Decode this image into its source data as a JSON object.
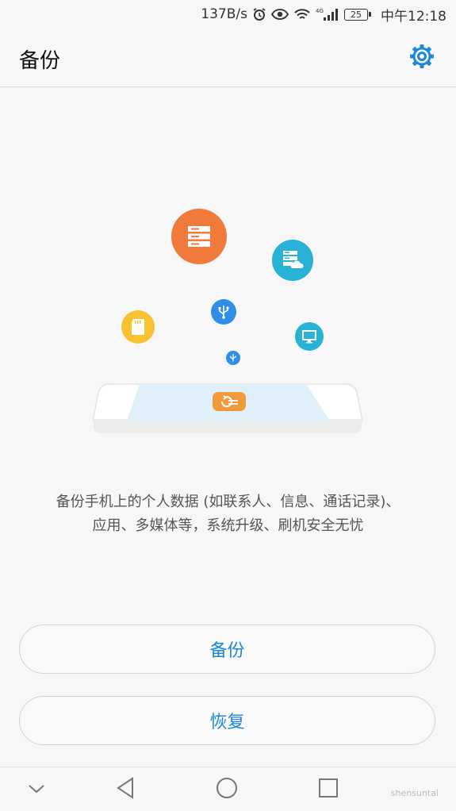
{
  "status_bar": {
    "speed": "137B/s",
    "network": "4G",
    "battery": "25",
    "time": "中午12:18"
  },
  "app_bar": {
    "title": "备份",
    "settings_icon": "gear-icon"
  },
  "illustration": {
    "icons": [
      "database-icon",
      "cloud-server-icon",
      "usb-icon",
      "sd-card-icon",
      "monitor-icon",
      "phone-backup-icon"
    ],
    "colors": {
      "orange": "#f07a3a",
      "teal": "#28b3d6",
      "blue": "#2f8ee8",
      "yellow": "#f7c232"
    }
  },
  "description": {
    "line1": "备份手机上的个人数据 (如联系人、信息、通话记录)、",
    "line2": "应用、多媒体等，系统升级、刷机安全无忧"
  },
  "buttons": {
    "backup": "备份",
    "restore": "恢复"
  },
  "nav": {
    "icons": [
      "chevron-down-icon",
      "back-icon",
      "home-icon",
      "recents-icon"
    ]
  },
  "watermark": "shensuntai",
  "colors": {
    "accent": "#1e88d8"
  }
}
